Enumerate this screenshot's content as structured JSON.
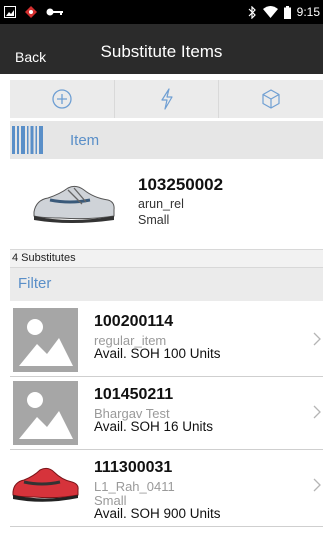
{
  "status_bar": {
    "time": "9:15"
  },
  "header": {
    "back_label": "Back",
    "title": "Substitute Items"
  },
  "toolbar": {
    "icons": [
      "plus-circle-icon",
      "lightning-icon",
      "cube-icon"
    ]
  },
  "scan_bar": {
    "label": "Item"
  },
  "main_item": {
    "number": "103250002",
    "description": "arun_rel",
    "size": "Small"
  },
  "substitutes_count": "4 Substitutes",
  "filter_label": "Filter",
  "substitutes": [
    {
      "number": "100200114",
      "description": "regular_item",
      "size": "",
      "soh": "Avail. SOH 100 Units"
    },
    {
      "number": "101450211",
      "description": "Bhargav Test",
      "size": "",
      "soh": "Avail. SOH 16 Units"
    },
    {
      "number": "111300031",
      "description": "L1_Rah_0411",
      "size": "Small",
      "soh": "Avail. SOH 900 Units"
    }
  ],
  "colors": {
    "accent": "#5a8fc8",
    "header_bg": "#2b2b2b",
    "toolbar_bg": "#ebebeb"
  }
}
